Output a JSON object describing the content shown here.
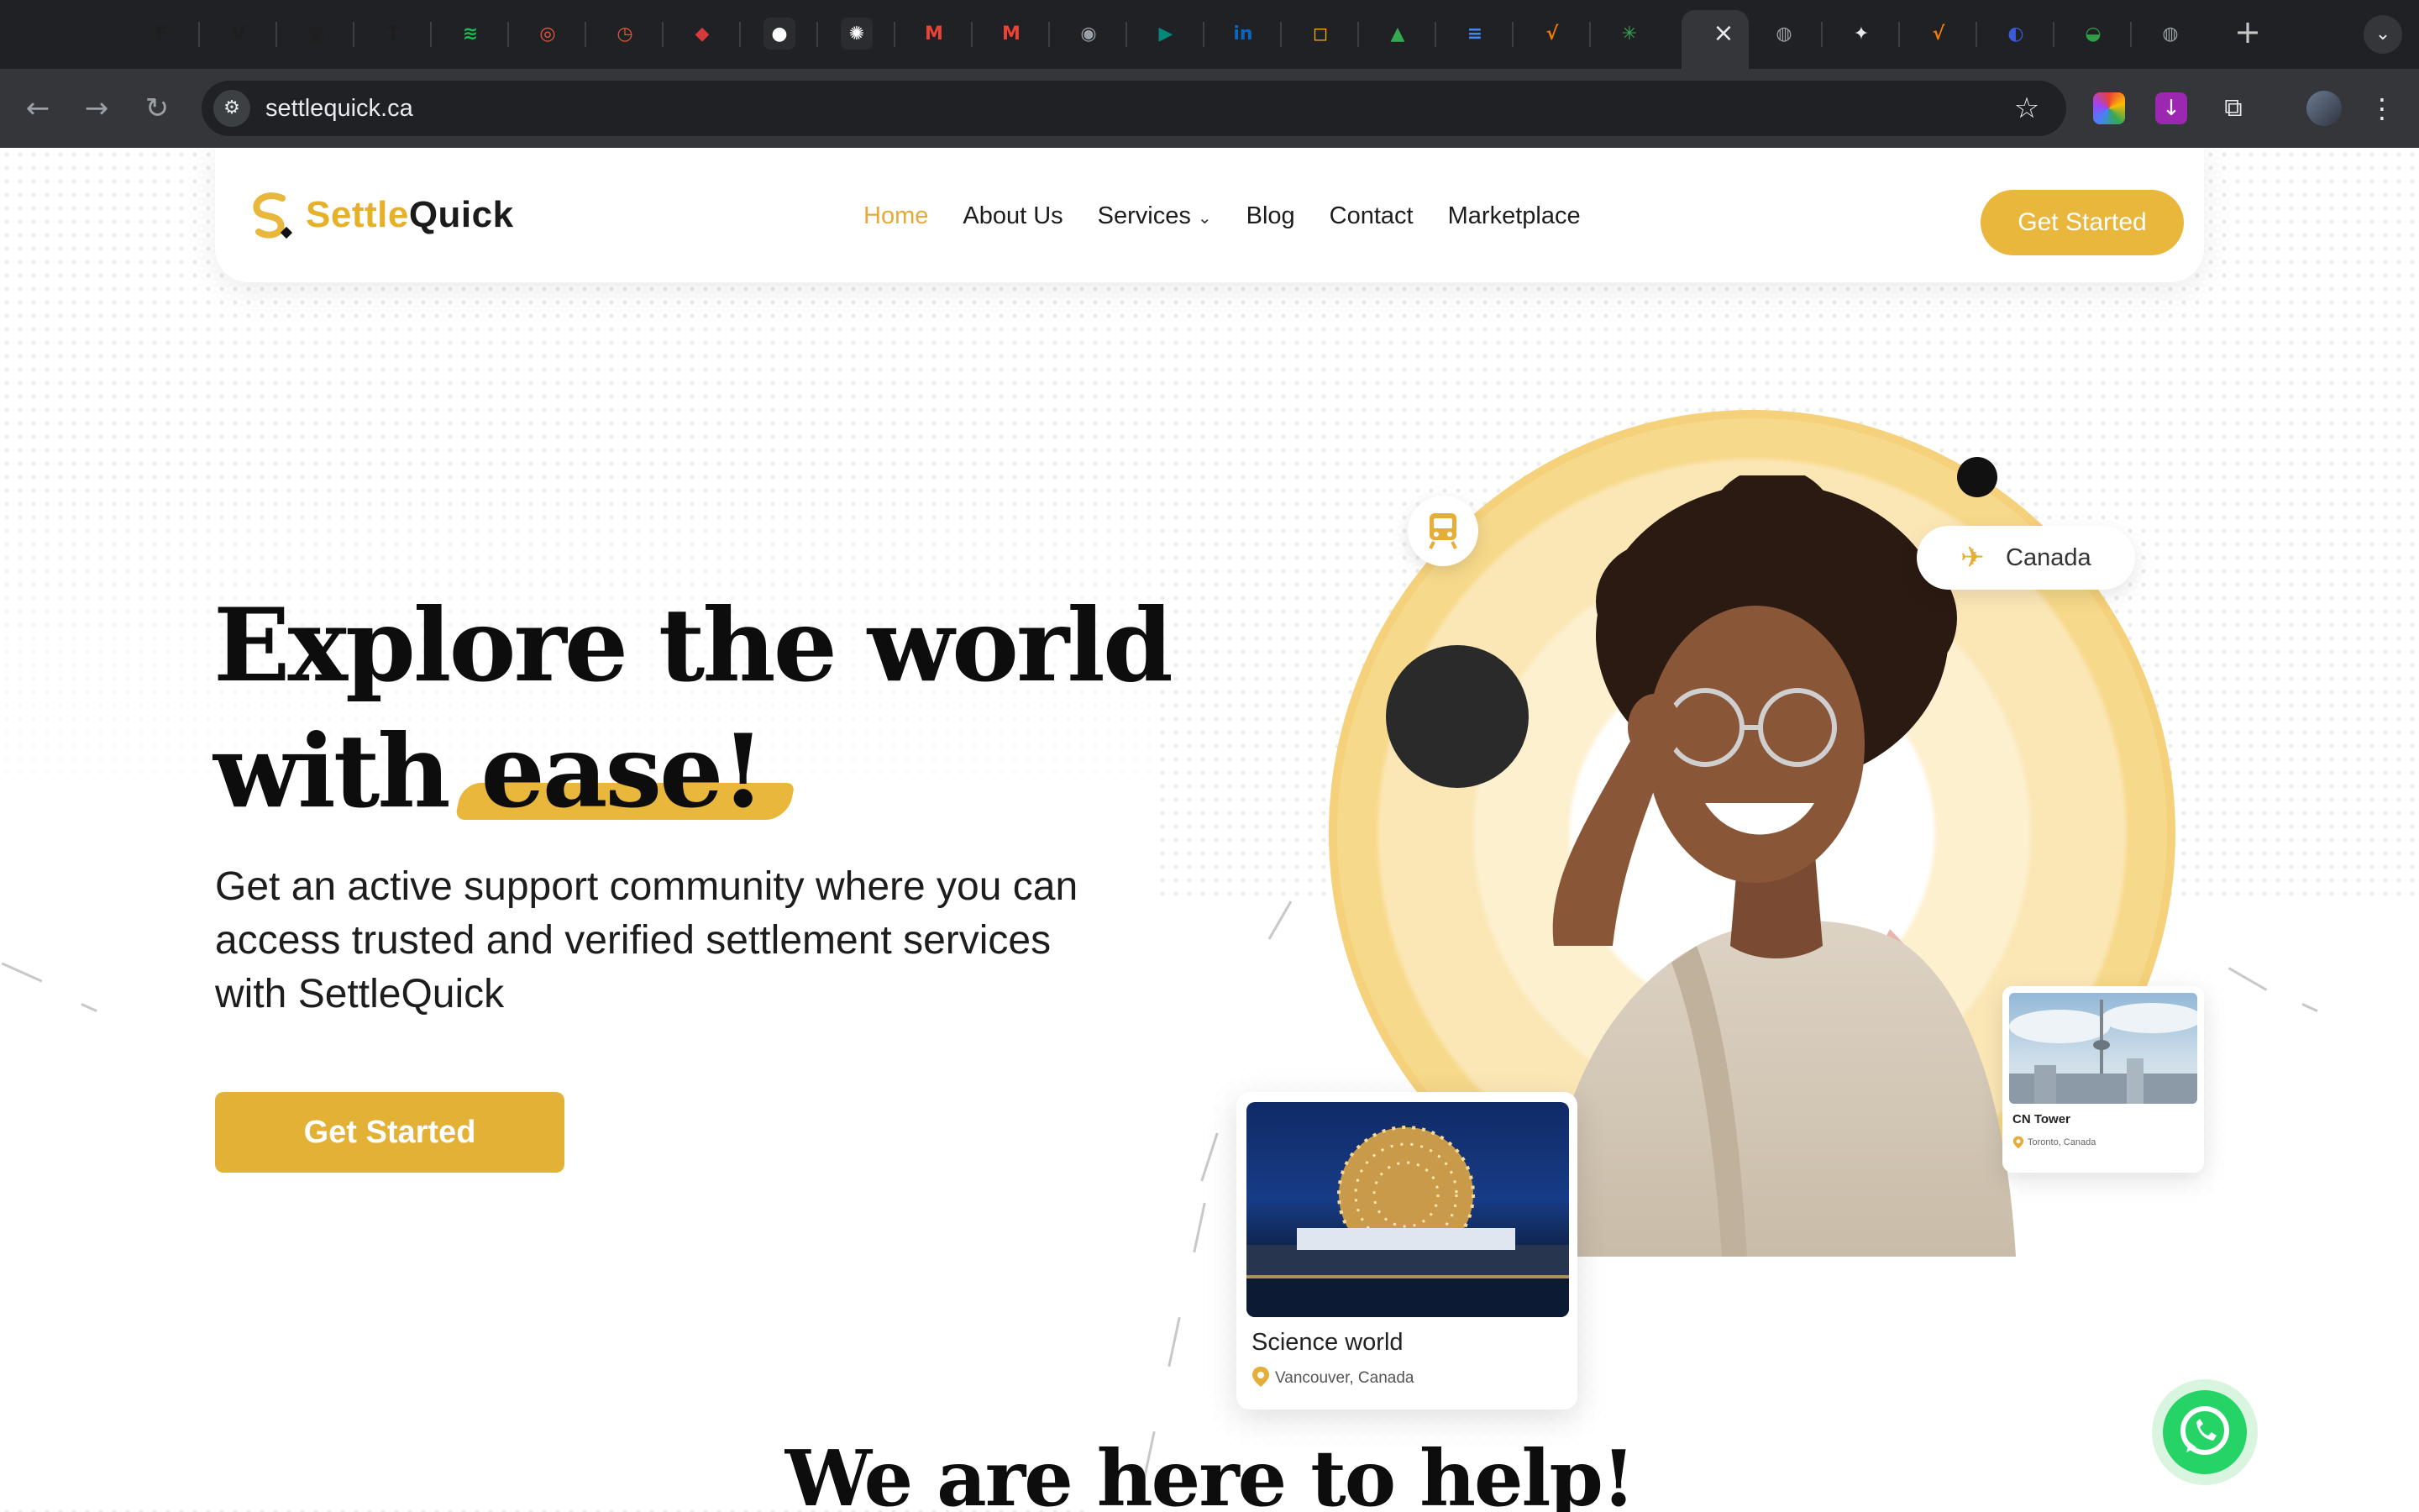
{
  "browser": {
    "tabs": [
      {
        "icon": "figma-icon",
        "color": "#1e1e1e",
        "glyph": "F"
      },
      {
        "icon": "vue-icon",
        "color": "#1e1e1e",
        "glyph": "V"
      },
      {
        "icon": "camera-icon",
        "color": "#1e1e1e",
        "glyph": "▣"
      },
      {
        "icon": "tradingview-icon",
        "color": "#1e1e1e",
        "glyph": "T"
      },
      {
        "icon": "spotify-icon",
        "color": "#1db954",
        "glyph": "≋"
      },
      {
        "icon": "target-icon",
        "color": "#e8553e",
        "glyph": "◎"
      },
      {
        "icon": "stopwatch-icon",
        "color": "#e8553e",
        "glyph": "◷"
      },
      {
        "icon": "shield-app-icon",
        "color": "#d63b3b",
        "glyph": "◆"
      },
      {
        "icon": "github-icon",
        "color": "#ffffff",
        "glyph": "●"
      },
      {
        "icon": "chatgpt-icon",
        "color": "#ffffff",
        "glyph": "✺"
      },
      {
        "icon": "gmail-icon",
        "color": "#ea4335",
        "glyph": "M"
      },
      {
        "icon": "gmail-icon",
        "color": "#ea4335",
        "glyph": "M"
      },
      {
        "icon": "chrome-icon",
        "color": "#9aa0a6",
        "glyph": "◉"
      },
      {
        "icon": "google-meet-icon",
        "color": "#00897b",
        "glyph": "▶"
      },
      {
        "icon": "linkedin-icon",
        "color": "#0a66c2",
        "glyph": "in"
      },
      {
        "icon": "chat-bubble-icon",
        "color": "#f4b400",
        "glyph": "◻"
      },
      {
        "icon": "google-drive-icon",
        "color": "#34a853",
        "glyph": "▲"
      },
      {
        "icon": "google-docs-icon",
        "color": "#4285f4",
        "glyph": "≡"
      },
      {
        "icon": "v-logo-icon",
        "color": "#f57c00",
        "glyph": "√"
      },
      {
        "icon": "asterisk-icon",
        "color": "#34a853",
        "glyph": "✳"
      },
      {
        "icon": "globe-icon",
        "color": "#9aa0a6",
        "glyph": "◍"
      },
      {
        "icon": "sparkle-icon",
        "color": "#e8eaed",
        "glyph": "✦"
      },
      {
        "icon": "v-logo-icon",
        "color": "#f57c00",
        "glyph": "√"
      },
      {
        "icon": "blue-app-icon",
        "color": "#3b5bdb",
        "glyph": "◐"
      },
      {
        "icon": "green-app-icon",
        "color": "#2f9e44",
        "glyph": "◒"
      },
      {
        "icon": "globe-icon",
        "color": "#9aa0a6",
        "glyph": "◍"
      }
    ],
    "url": "settlequick.ca",
    "new_tab": "+",
    "close": "×"
  },
  "nav": {
    "logo_part1": "Settle",
    "logo_part2": "Quick",
    "items": [
      "Home",
      "About Us",
      "Services",
      "Blog",
      "Contact",
      "Marketplace"
    ],
    "active": "Home",
    "cta": "Get Started"
  },
  "hero": {
    "title_line1": "Explore the world",
    "title_line2_a": "with",
    "title_line2_b": "ease!",
    "subtitle": "Get an active support community where you can access trusted and verified settlement services with SettleQuick",
    "cta": "Get Started",
    "badge": "Canada",
    "card_main": {
      "title": "Science world",
      "location": "Vancouver, Canada"
    },
    "card_small": {
      "title": "CN Tower",
      "location": "Toronto, Canada"
    }
  },
  "section": {
    "title": "We are here to help!"
  },
  "colors": {
    "accent": "#E8B73B",
    "active_nav": "#E6A93A",
    "dark": "#0D0D0D",
    "whatsapp": "#25D366"
  }
}
